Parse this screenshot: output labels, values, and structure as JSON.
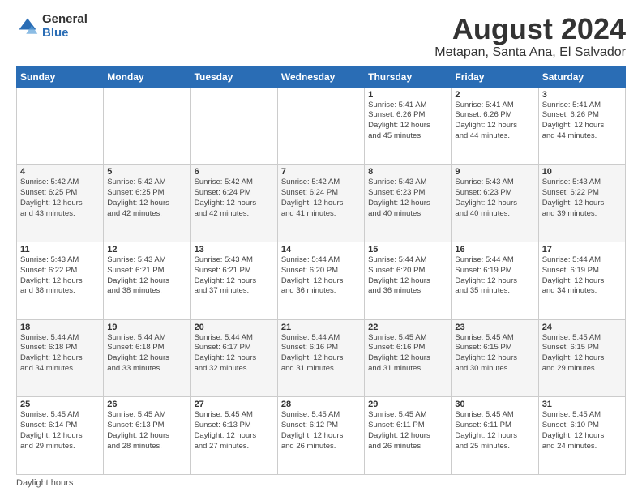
{
  "logo": {
    "general": "General",
    "blue": "Blue"
  },
  "title": "August 2024",
  "subtitle": "Metapan, Santa Ana, El Salvador",
  "days_of_week": [
    "Sunday",
    "Monday",
    "Tuesday",
    "Wednesday",
    "Thursday",
    "Friday",
    "Saturday"
  ],
  "footer": "Daylight hours",
  "weeks": [
    [
      {
        "day": "",
        "info": ""
      },
      {
        "day": "",
        "info": ""
      },
      {
        "day": "",
        "info": ""
      },
      {
        "day": "",
        "info": ""
      },
      {
        "day": "1",
        "info": "Sunrise: 5:41 AM\nSunset: 6:26 PM\nDaylight: 12 hours\nand 45 minutes."
      },
      {
        "day": "2",
        "info": "Sunrise: 5:41 AM\nSunset: 6:26 PM\nDaylight: 12 hours\nand 44 minutes."
      },
      {
        "day": "3",
        "info": "Sunrise: 5:41 AM\nSunset: 6:26 PM\nDaylight: 12 hours\nand 44 minutes."
      }
    ],
    [
      {
        "day": "4",
        "info": "Sunrise: 5:42 AM\nSunset: 6:25 PM\nDaylight: 12 hours\nand 43 minutes."
      },
      {
        "day": "5",
        "info": "Sunrise: 5:42 AM\nSunset: 6:25 PM\nDaylight: 12 hours\nand 42 minutes."
      },
      {
        "day": "6",
        "info": "Sunrise: 5:42 AM\nSunset: 6:24 PM\nDaylight: 12 hours\nand 42 minutes."
      },
      {
        "day": "7",
        "info": "Sunrise: 5:42 AM\nSunset: 6:24 PM\nDaylight: 12 hours\nand 41 minutes."
      },
      {
        "day": "8",
        "info": "Sunrise: 5:43 AM\nSunset: 6:23 PM\nDaylight: 12 hours\nand 40 minutes."
      },
      {
        "day": "9",
        "info": "Sunrise: 5:43 AM\nSunset: 6:23 PM\nDaylight: 12 hours\nand 40 minutes."
      },
      {
        "day": "10",
        "info": "Sunrise: 5:43 AM\nSunset: 6:22 PM\nDaylight: 12 hours\nand 39 minutes."
      }
    ],
    [
      {
        "day": "11",
        "info": "Sunrise: 5:43 AM\nSunset: 6:22 PM\nDaylight: 12 hours\nand 38 minutes."
      },
      {
        "day": "12",
        "info": "Sunrise: 5:43 AM\nSunset: 6:21 PM\nDaylight: 12 hours\nand 38 minutes."
      },
      {
        "day": "13",
        "info": "Sunrise: 5:43 AM\nSunset: 6:21 PM\nDaylight: 12 hours\nand 37 minutes."
      },
      {
        "day": "14",
        "info": "Sunrise: 5:44 AM\nSunset: 6:20 PM\nDaylight: 12 hours\nand 36 minutes."
      },
      {
        "day": "15",
        "info": "Sunrise: 5:44 AM\nSunset: 6:20 PM\nDaylight: 12 hours\nand 36 minutes."
      },
      {
        "day": "16",
        "info": "Sunrise: 5:44 AM\nSunset: 6:19 PM\nDaylight: 12 hours\nand 35 minutes."
      },
      {
        "day": "17",
        "info": "Sunrise: 5:44 AM\nSunset: 6:19 PM\nDaylight: 12 hours\nand 34 minutes."
      }
    ],
    [
      {
        "day": "18",
        "info": "Sunrise: 5:44 AM\nSunset: 6:18 PM\nDaylight: 12 hours\nand 34 minutes."
      },
      {
        "day": "19",
        "info": "Sunrise: 5:44 AM\nSunset: 6:18 PM\nDaylight: 12 hours\nand 33 minutes."
      },
      {
        "day": "20",
        "info": "Sunrise: 5:44 AM\nSunset: 6:17 PM\nDaylight: 12 hours\nand 32 minutes."
      },
      {
        "day": "21",
        "info": "Sunrise: 5:44 AM\nSunset: 6:16 PM\nDaylight: 12 hours\nand 31 minutes."
      },
      {
        "day": "22",
        "info": "Sunrise: 5:45 AM\nSunset: 6:16 PM\nDaylight: 12 hours\nand 31 minutes."
      },
      {
        "day": "23",
        "info": "Sunrise: 5:45 AM\nSunset: 6:15 PM\nDaylight: 12 hours\nand 30 minutes."
      },
      {
        "day": "24",
        "info": "Sunrise: 5:45 AM\nSunset: 6:15 PM\nDaylight: 12 hours\nand 29 minutes."
      }
    ],
    [
      {
        "day": "25",
        "info": "Sunrise: 5:45 AM\nSunset: 6:14 PM\nDaylight: 12 hours\nand 29 minutes."
      },
      {
        "day": "26",
        "info": "Sunrise: 5:45 AM\nSunset: 6:13 PM\nDaylight: 12 hours\nand 28 minutes."
      },
      {
        "day": "27",
        "info": "Sunrise: 5:45 AM\nSunset: 6:13 PM\nDaylight: 12 hours\nand 27 minutes."
      },
      {
        "day": "28",
        "info": "Sunrise: 5:45 AM\nSunset: 6:12 PM\nDaylight: 12 hours\nand 26 minutes."
      },
      {
        "day": "29",
        "info": "Sunrise: 5:45 AM\nSunset: 6:11 PM\nDaylight: 12 hours\nand 26 minutes."
      },
      {
        "day": "30",
        "info": "Sunrise: 5:45 AM\nSunset: 6:11 PM\nDaylight: 12 hours\nand 25 minutes."
      },
      {
        "day": "31",
        "info": "Sunrise: 5:45 AM\nSunset: 6:10 PM\nDaylight: 12 hours\nand 24 minutes."
      }
    ]
  ]
}
